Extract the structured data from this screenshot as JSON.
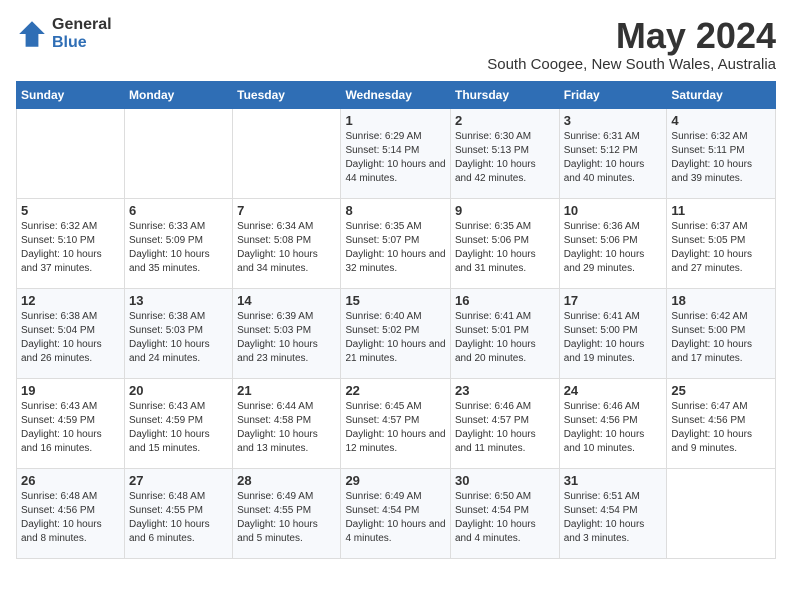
{
  "header": {
    "logo_general": "General",
    "logo_blue": "Blue",
    "month_title": "May 2024",
    "location": "South Coogee, New South Wales, Australia"
  },
  "days_of_week": [
    "Sunday",
    "Monday",
    "Tuesday",
    "Wednesday",
    "Thursday",
    "Friday",
    "Saturday"
  ],
  "weeks": [
    [
      {
        "day": "",
        "sunrise": "",
        "sunset": "",
        "daylight": ""
      },
      {
        "day": "",
        "sunrise": "",
        "sunset": "",
        "daylight": ""
      },
      {
        "day": "",
        "sunrise": "",
        "sunset": "",
        "daylight": ""
      },
      {
        "day": "1",
        "sunrise": "Sunrise: 6:29 AM",
        "sunset": "Sunset: 5:14 PM",
        "daylight": "Daylight: 10 hours and 44 minutes."
      },
      {
        "day": "2",
        "sunrise": "Sunrise: 6:30 AM",
        "sunset": "Sunset: 5:13 PM",
        "daylight": "Daylight: 10 hours and 42 minutes."
      },
      {
        "day": "3",
        "sunrise": "Sunrise: 6:31 AM",
        "sunset": "Sunset: 5:12 PM",
        "daylight": "Daylight: 10 hours and 40 minutes."
      },
      {
        "day": "4",
        "sunrise": "Sunrise: 6:32 AM",
        "sunset": "Sunset: 5:11 PM",
        "daylight": "Daylight: 10 hours and 39 minutes."
      }
    ],
    [
      {
        "day": "5",
        "sunrise": "Sunrise: 6:32 AM",
        "sunset": "Sunset: 5:10 PM",
        "daylight": "Daylight: 10 hours and 37 minutes."
      },
      {
        "day": "6",
        "sunrise": "Sunrise: 6:33 AM",
        "sunset": "Sunset: 5:09 PM",
        "daylight": "Daylight: 10 hours and 35 minutes."
      },
      {
        "day": "7",
        "sunrise": "Sunrise: 6:34 AM",
        "sunset": "Sunset: 5:08 PM",
        "daylight": "Daylight: 10 hours and 34 minutes."
      },
      {
        "day": "8",
        "sunrise": "Sunrise: 6:35 AM",
        "sunset": "Sunset: 5:07 PM",
        "daylight": "Daylight: 10 hours and 32 minutes."
      },
      {
        "day": "9",
        "sunrise": "Sunrise: 6:35 AM",
        "sunset": "Sunset: 5:06 PM",
        "daylight": "Daylight: 10 hours and 31 minutes."
      },
      {
        "day": "10",
        "sunrise": "Sunrise: 6:36 AM",
        "sunset": "Sunset: 5:06 PM",
        "daylight": "Daylight: 10 hours and 29 minutes."
      },
      {
        "day": "11",
        "sunrise": "Sunrise: 6:37 AM",
        "sunset": "Sunset: 5:05 PM",
        "daylight": "Daylight: 10 hours and 27 minutes."
      }
    ],
    [
      {
        "day": "12",
        "sunrise": "Sunrise: 6:38 AM",
        "sunset": "Sunset: 5:04 PM",
        "daylight": "Daylight: 10 hours and 26 minutes."
      },
      {
        "day": "13",
        "sunrise": "Sunrise: 6:38 AM",
        "sunset": "Sunset: 5:03 PM",
        "daylight": "Daylight: 10 hours and 24 minutes."
      },
      {
        "day": "14",
        "sunrise": "Sunrise: 6:39 AM",
        "sunset": "Sunset: 5:03 PM",
        "daylight": "Daylight: 10 hours and 23 minutes."
      },
      {
        "day": "15",
        "sunrise": "Sunrise: 6:40 AM",
        "sunset": "Sunset: 5:02 PM",
        "daylight": "Daylight: 10 hours and 21 minutes."
      },
      {
        "day": "16",
        "sunrise": "Sunrise: 6:41 AM",
        "sunset": "Sunset: 5:01 PM",
        "daylight": "Daylight: 10 hours and 20 minutes."
      },
      {
        "day": "17",
        "sunrise": "Sunrise: 6:41 AM",
        "sunset": "Sunset: 5:00 PM",
        "daylight": "Daylight: 10 hours and 19 minutes."
      },
      {
        "day": "18",
        "sunrise": "Sunrise: 6:42 AM",
        "sunset": "Sunset: 5:00 PM",
        "daylight": "Daylight: 10 hours and 17 minutes."
      }
    ],
    [
      {
        "day": "19",
        "sunrise": "Sunrise: 6:43 AM",
        "sunset": "Sunset: 4:59 PM",
        "daylight": "Daylight: 10 hours and 16 minutes."
      },
      {
        "day": "20",
        "sunrise": "Sunrise: 6:43 AM",
        "sunset": "Sunset: 4:59 PM",
        "daylight": "Daylight: 10 hours and 15 minutes."
      },
      {
        "day": "21",
        "sunrise": "Sunrise: 6:44 AM",
        "sunset": "Sunset: 4:58 PM",
        "daylight": "Daylight: 10 hours and 13 minutes."
      },
      {
        "day": "22",
        "sunrise": "Sunrise: 6:45 AM",
        "sunset": "Sunset: 4:57 PM",
        "daylight": "Daylight: 10 hours and 12 minutes."
      },
      {
        "day": "23",
        "sunrise": "Sunrise: 6:46 AM",
        "sunset": "Sunset: 4:57 PM",
        "daylight": "Daylight: 10 hours and 11 minutes."
      },
      {
        "day": "24",
        "sunrise": "Sunrise: 6:46 AM",
        "sunset": "Sunset: 4:56 PM",
        "daylight": "Daylight: 10 hours and 10 minutes."
      },
      {
        "day": "25",
        "sunrise": "Sunrise: 6:47 AM",
        "sunset": "Sunset: 4:56 PM",
        "daylight": "Daylight: 10 hours and 9 minutes."
      }
    ],
    [
      {
        "day": "26",
        "sunrise": "Sunrise: 6:48 AM",
        "sunset": "Sunset: 4:56 PM",
        "daylight": "Daylight: 10 hours and 8 minutes."
      },
      {
        "day": "27",
        "sunrise": "Sunrise: 6:48 AM",
        "sunset": "Sunset: 4:55 PM",
        "daylight": "Daylight: 10 hours and 6 minutes."
      },
      {
        "day": "28",
        "sunrise": "Sunrise: 6:49 AM",
        "sunset": "Sunset: 4:55 PM",
        "daylight": "Daylight: 10 hours and 5 minutes."
      },
      {
        "day": "29",
        "sunrise": "Sunrise: 6:49 AM",
        "sunset": "Sunset: 4:54 PM",
        "daylight": "Daylight: 10 hours and 4 minutes."
      },
      {
        "day": "30",
        "sunrise": "Sunrise: 6:50 AM",
        "sunset": "Sunset: 4:54 PM",
        "daylight": "Daylight: 10 hours and 4 minutes."
      },
      {
        "day": "31",
        "sunrise": "Sunrise: 6:51 AM",
        "sunset": "Sunset: 4:54 PM",
        "daylight": "Daylight: 10 hours and 3 minutes."
      },
      {
        "day": "",
        "sunrise": "",
        "sunset": "",
        "daylight": ""
      }
    ]
  ]
}
